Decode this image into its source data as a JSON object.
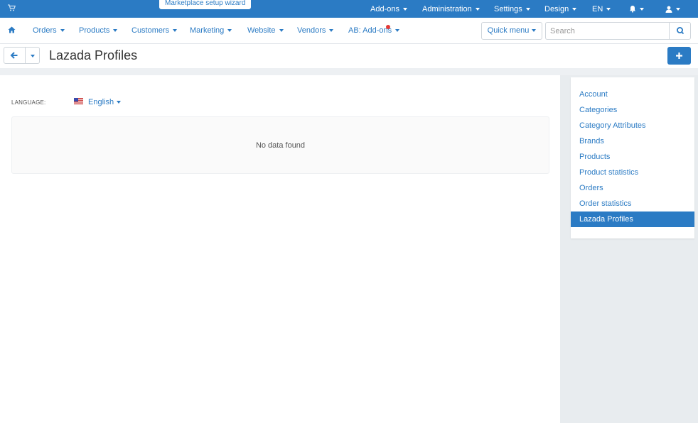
{
  "topbar": {
    "wizard_label": "Marketplace setup wizard",
    "items": [
      "Add-ons",
      "Administration",
      "Settings",
      "Design",
      "EN"
    ]
  },
  "nav": {
    "items": [
      "Orders",
      "Products",
      "Customers",
      "Marketing",
      "Website",
      "Vendors",
      "AB: Add-ons"
    ],
    "quick_menu": "Quick menu",
    "search_placeholder": "Search"
  },
  "page": {
    "title": "Lazada Profiles",
    "language_label": "LANGUAGE:",
    "language_value": "English",
    "empty_text": "No data found"
  },
  "sidebar": {
    "items": [
      "Account",
      "Categories",
      "Category Attributes",
      "Brands",
      "Products",
      "Product statistics",
      "Orders",
      "Order statistics",
      "Lazada Profiles"
    ],
    "active_index": 8
  },
  "colors": {
    "accent": "#2b7bc4",
    "panel": "#e8ecef"
  },
  "icons": [
    "cart-icon",
    "bell-icon",
    "user-icon",
    "home-icon",
    "search-icon",
    "back-arrow-icon",
    "plus-icon",
    "us-flag-icon"
  ]
}
